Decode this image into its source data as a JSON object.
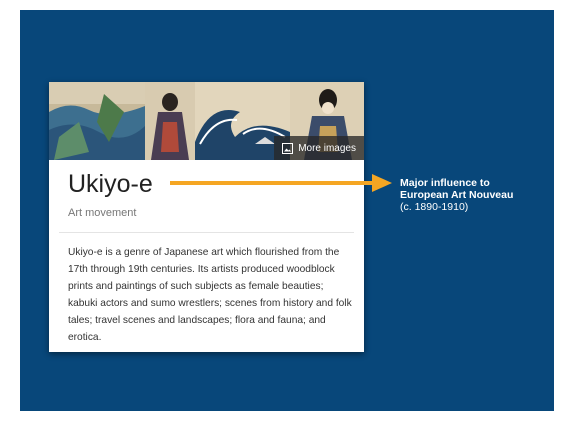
{
  "card": {
    "more_images_label": "More images",
    "title": "Ukiyo-e",
    "subtitle": "Art movement",
    "description": "Ukiyo-e is a genre of Japanese art which flourished from the 17th through 19th centuries. Its artists produced woodblock prints and paintings of such subjects as female beauties; kabuki actors and sumo wrestlers; scenes from history and folk tales; travel scenes and landscapes; flora and fauna; and erotica."
  },
  "callout": {
    "line1": "Major influence to",
    "line2": "European Art Nouveau",
    "line3": "(c. 1890-1910)"
  },
  "colors": {
    "slide_background": "#08477a",
    "arrow": "#f5a623"
  }
}
